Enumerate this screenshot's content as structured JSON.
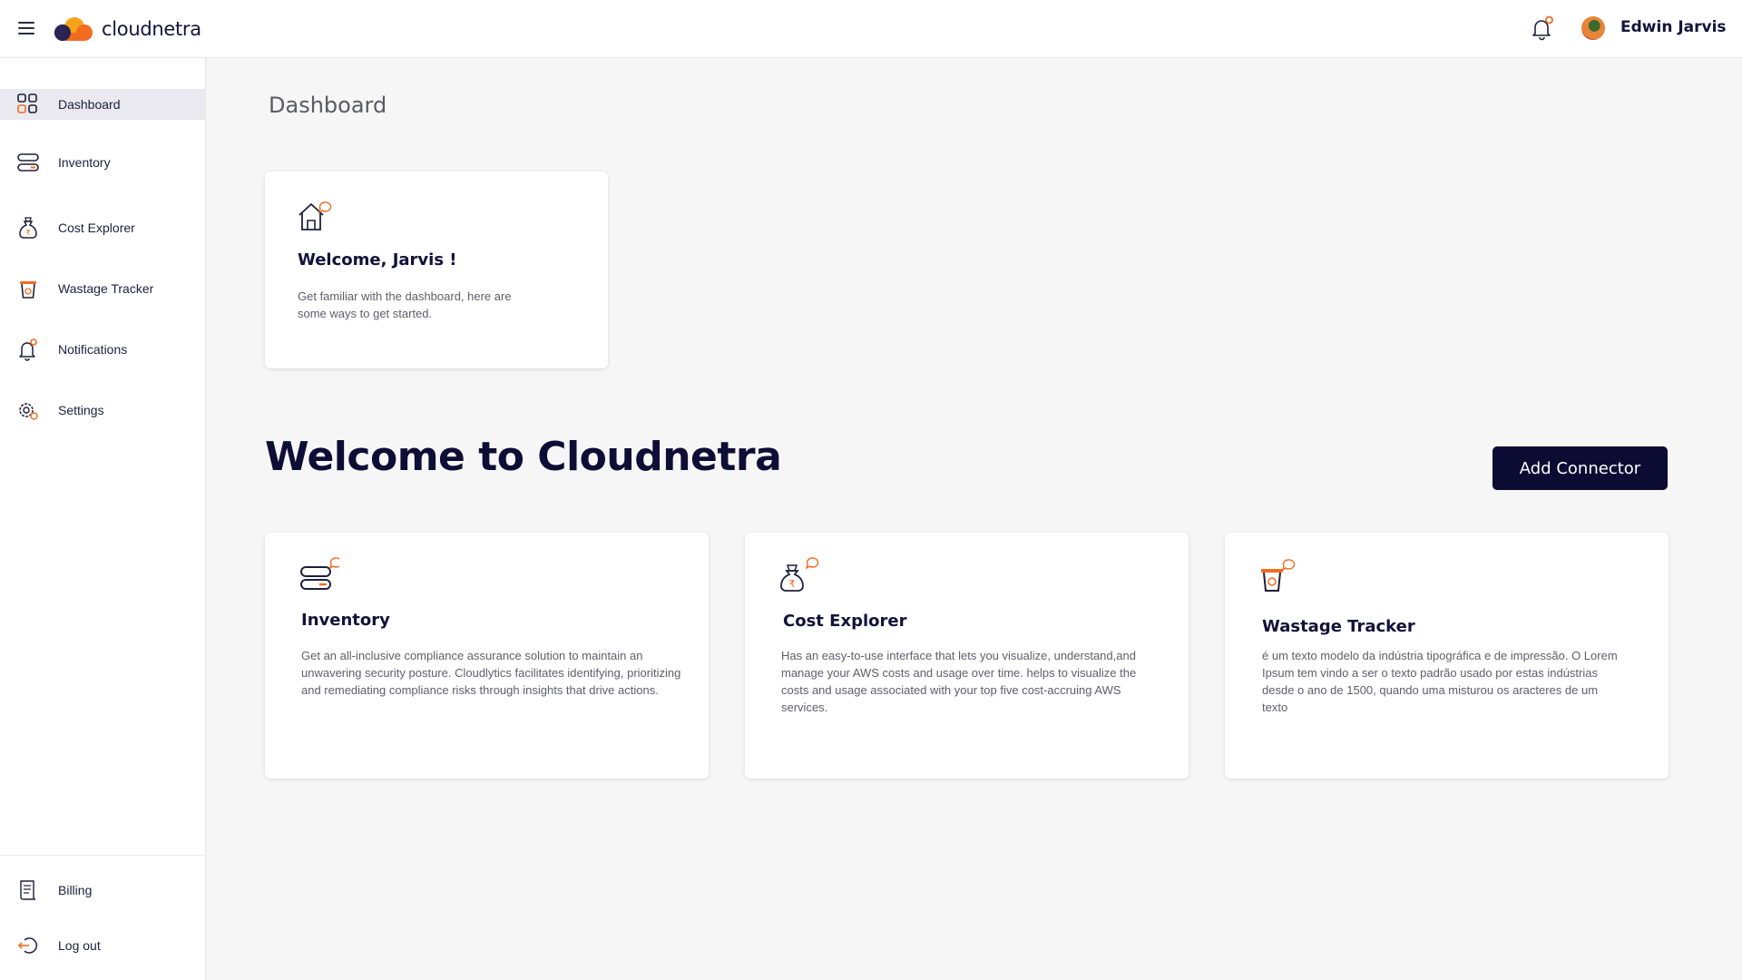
{
  "header": {
    "logo_text": "cloudnetra",
    "user_name": "Edwin Jarvis"
  },
  "sidebar": {
    "items": [
      {
        "label": "Dashboard",
        "icon": "grid-icon",
        "active": true
      },
      {
        "label": "Inventory",
        "icon": "server-icon"
      },
      {
        "label": "Cost Explorer",
        "icon": "money-bag-icon"
      },
      {
        "label": "Wastage Tracker",
        "icon": "trash-icon"
      },
      {
        "label": "Notifications",
        "icon": "bell-icon"
      },
      {
        "label": "Settings",
        "icon": "gear-icon"
      }
    ],
    "bottom_items": [
      {
        "label": "Billing",
        "icon": "receipt-icon"
      },
      {
        "label": "Log out",
        "icon": "logout-icon"
      }
    ]
  },
  "main": {
    "page_title": "Dashboard",
    "welcome_card": {
      "title": "Welcome, Jarvis !",
      "description": "Get familiar with the dashboard, here are some ways to get started."
    },
    "hero_title": "Welcome to Cloudnetra",
    "add_connector_label": "Add Connector",
    "feature_cards": [
      {
        "title": "Inventory",
        "description": "Get an all-inclusive compliance assurance solution to maintain an unwavering security posture. Cloudlytics facilitates identifying, prioritizing and remediating compliance risks through insights that drive actions."
      },
      {
        "title": "Cost Explorer",
        "description": "Has an easy-to-use interface that lets you visualize, understand,and manage your AWS costs and usage over time. helps to visualize the costs and usage associated with your top five cost-accruing AWS services."
      },
      {
        "title": "Wastage Tracker",
        "description": "é um texto modelo da indústria tipográfica e de impressão. O Lorem Ipsum tem vindo a ser o texto padrão usado por estas indústrias desde o ano de 1500, quando uma misturou os aracteres de um texto"
      }
    ]
  },
  "colors": {
    "accent": "#f26b21",
    "brand_dark": "#0b0b33",
    "background": "#f6f6f6"
  }
}
